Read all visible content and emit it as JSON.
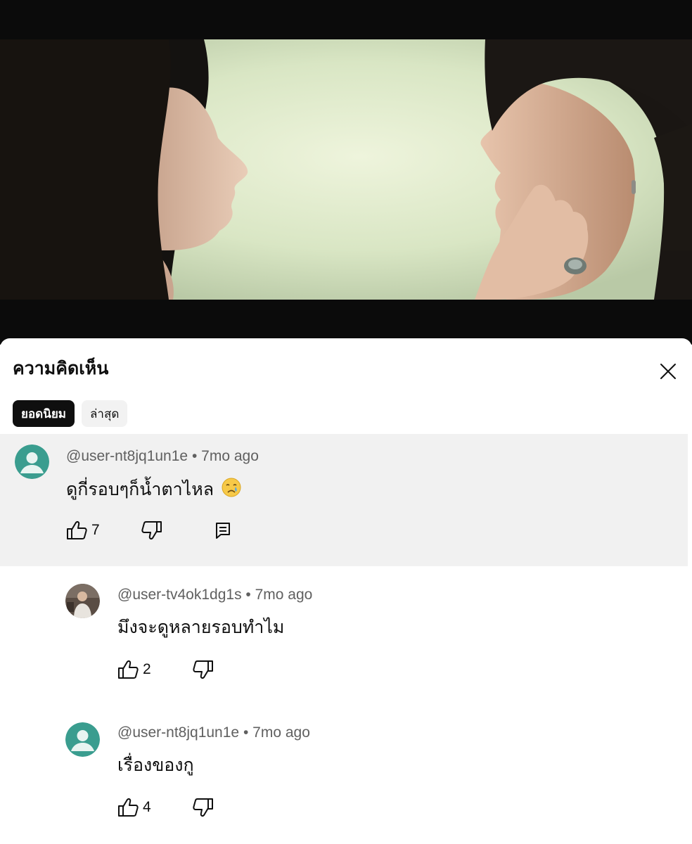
{
  "comments_panel": {
    "title": "ความคิดเห็น",
    "filters": [
      {
        "label": "ยอดนิยม",
        "selected": true
      },
      {
        "label": "ล่าสุด",
        "selected": false
      }
    ]
  },
  "comments": [
    {
      "author": "@user-nt8jq1un1e",
      "age": "7mo ago",
      "text": "ดูกี่รอบๆก็น้ำตาไหล",
      "emoji": "crying-face",
      "likes": "7",
      "highlighted": true
    },
    {
      "author": "@user-tv4ok1dg1s",
      "age": "7mo ago",
      "text": "มึงจะดูหลายรอบทำไม",
      "likes": "2",
      "is_reply": true
    },
    {
      "author": "@user-nt8jq1un1e",
      "age": "7mo ago",
      "text": "เรื่องของกู",
      "likes": "4",
      "is_reply": true
    }
  ],
  "separator": "•",
  "colors": {
    "highlight_bg": "#f1f1f1",
    "avatar_default": "#3a9d8f",
    "meta_text": "#606060",
    "chip_active_bg": "#0f0f0f"
  }
}
